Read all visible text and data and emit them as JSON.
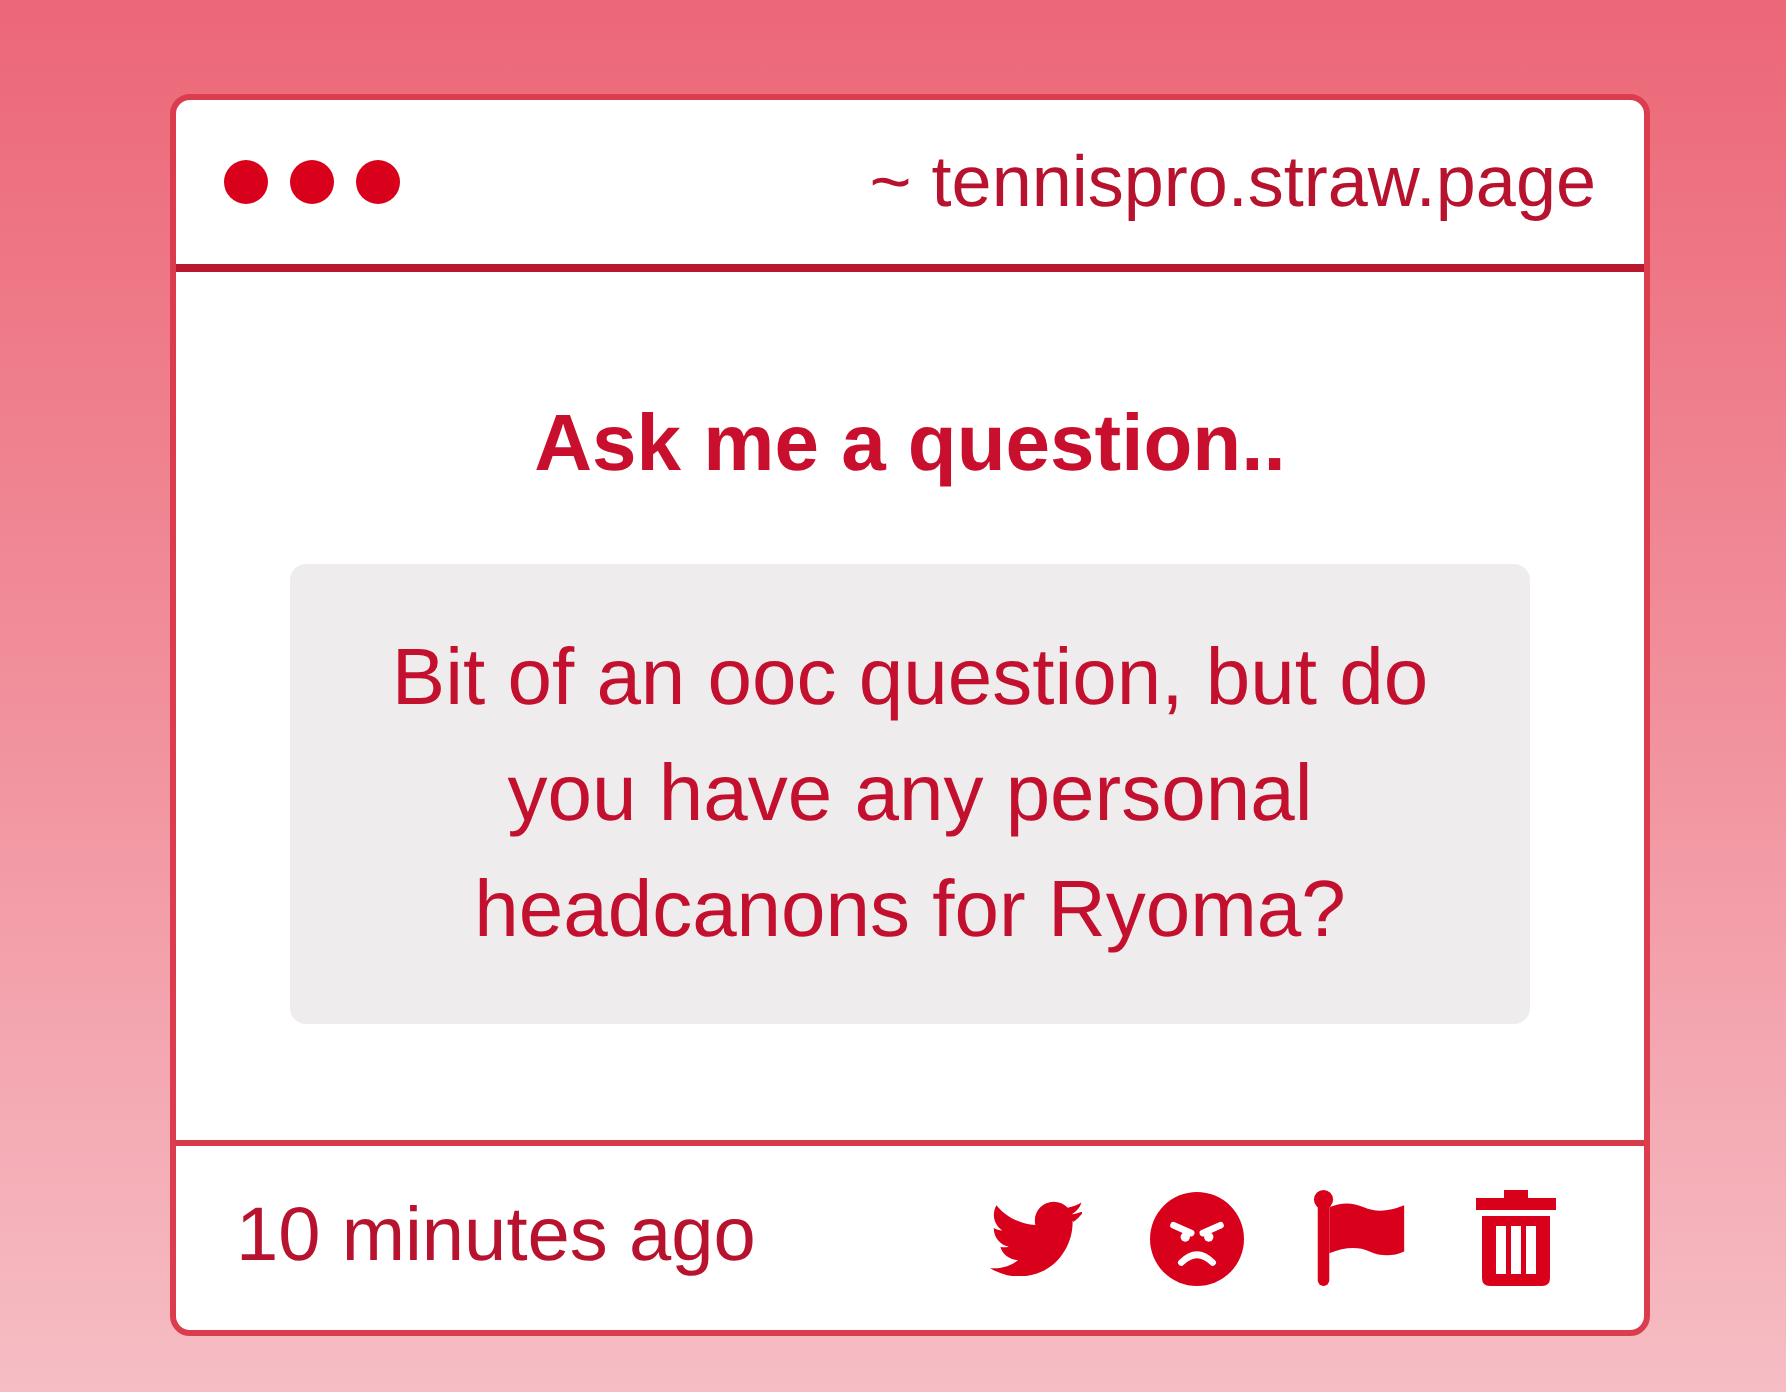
{
  "window": {
    "address": "~ tennispro.straw.page"
  },
  "prompt": {
    "title": "Ask me a question.."
  },
  "question": {
    "text": "Bit of an ooc question, but do you have any personal headcanons for Ryoma?"
  },
  "footer": {
    "time": "10 minutes ago"
  }
}
